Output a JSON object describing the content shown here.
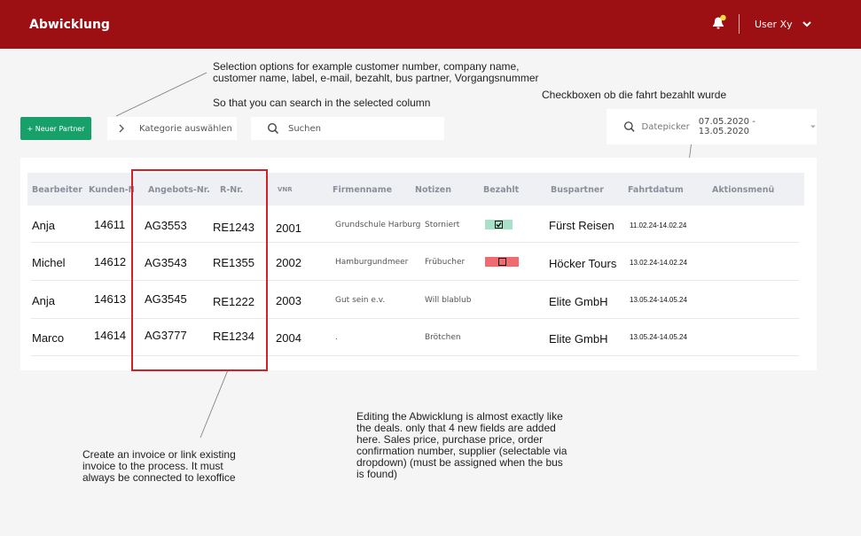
{
  "header": {
    "title": "Abwicklung",
    "user_name": "User Xy",
    "bell_badge_color": "#f2e233",
    "bg_color": "#9c0f12"
  },
  "toolbar": {
    "new_partner_label": "+ Neuer Partner",
    "category_placeholder": "Kategorie auswählen",
    "search_placeholder": "Suchen",
    "datepicker_label": "Datepicker",
    "date_range": "07.05.2020 - 13.05.2020"
  },
  "table": {
    "headers": [
      "Bearbeiter",
      "Kunden-Nr.",
      "Angebots-Nr.",
      "R-Nr.",
      "VNR",
      "Firmenname",
      "Notizen",
      "Bezahlt",
      "Buspartner",
      "Fahrtdatum",
      "Aktionsmenü"
    ],
    "rows": [
      {
        "bearbeiter": "Anja",
        "kunden": "14611",
        "angebot": "AG3553",
        "rnr": "RE1243",
        "vnr": "2001",
        "firma": "Grundschule Harburg",
        "notizen": "Storniert",
        "bezahlt": true,
        "bus": "Fürst Reisen",
        "datum": "11.02.24-14.02.24"
      },
      {
        "bearbeiter": "Michel",
        "kunden": "14612",
        "angebot": "AG3543",
        "rnr": "RE1355",
        "vnr": "2002",
        "firma": "Hamburgundmeer",
        "notizen": "Frübucher",
        "bezahlt": false,
        "bus": "Höcker Tours",
        "datum": "13.02.24-14.02.24"
      },
      {
        "bearbeiter": "Anja",
        "kunden": "14613",
        "angebot": "AG3545",
        "rnr": "RE1222",
        "vnr": "2003",
        "firma": "Gut sein e.v.",
        "notizen": "Will blablub",
        "bezahlt": null,
        "bus": "Elite GmbH",
        "datum": "13.05.24-14.05.24"
      },
      {
        "bearbeiter": "Marco",
        "kunden": "14614",
        "angebot": "AG3777",
        "rnr": "RE1234",
        "vnr": "2004",
        "firma": ".",
        "notizen": "Brötchen",
        "bezahlt": null,
        "bus": "Elite GmbH",
        "datum": "13.05.24-14.05.24"
      }
    ],
    "paid_colors": {
      "paid": "#a8e0c8",
      "unpaid": "#ef6b6e"
    }
  },
  "annotations": {
    "selection_line1": "Selection options for example customer number, company name,",
    "selection_line2": "customer name, label, e-mail, bezahlt, bus partner, Vorgangsnummer",
    "search_note": "So that you can search in the selected column",
    "checkbox_note": "Checkboxen ob die fahrt bezahlt wurde",
    "invoice_line1": "Create an invoice or link existing",
    "invoice_line2": "invoice to the process. It must",
    "invoice_line3": "always be connected to lexoffice",
    "edit_line1": "Editing the Abwicklung is almost exactly like",
    "edit_line2": "the deals. only that 4 new fields are added",
    "edit_line3": "here. Sales price, purchase price, order",
    "edit_line4": "confirmation number, supplier (selectable via",
    "edit_line5": "dropdown) (must be assigned when the bus",
    "edit_line6": "is found)"
  }
}
